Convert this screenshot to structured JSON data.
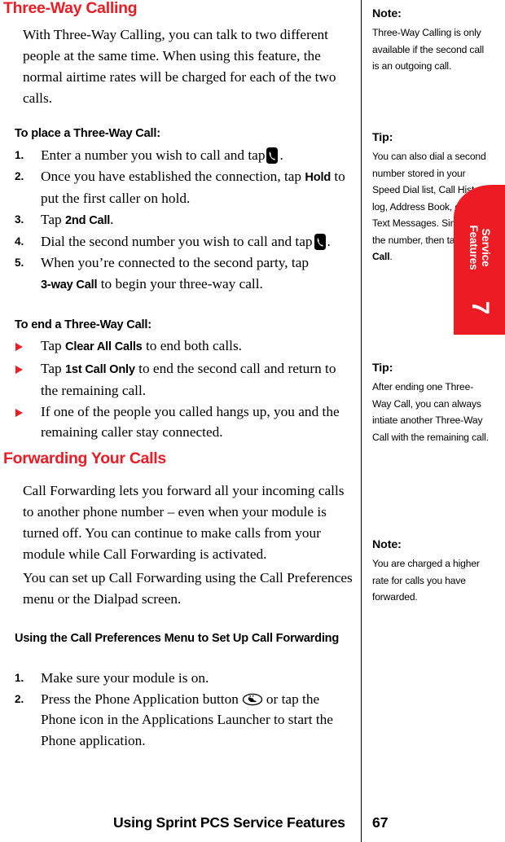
{
  "page": {
    "number": "67",
    "footer_title": "Using Sprint PCS Service Features",
    "accent_color": "#ED1C24"
  },
  "chapter_tab": {
    "label_line1": "Service",
    "label_line2": "Features",
    "number": "7"
  },
  "main": {
    "section1": {
      "title": "Three-Way Calling",
      "intro": "With Three-Way Calling, you can talk to two different people at the same time. When using this feature, the normal airtime rates will be charged for each of the two calls.",
      "place_heading": "To place a Three-Way Call:",
      "place_steps": [
        {
          "num": "1.",
          "text_before": "Enter a number you wish to call and tap",
          "icon": "phone-key-icon",
          "text_after": "."
        },
        {
          "num": "2.",
          "text_before": "Once you have established the connection, tap",
          "ui_term": "Hold",
          "text_after": "to put the first caller on hold."
        },
        {
          "num": "3.",
          "text_before": "Tap",
          "ui_term": "2nd Call",
          "text_after": "."
        },
        {
          "num": "4.",
          "text_before": "Dial the second number you wish to call and tap",
          "icon": "phone-key-icon",
          "text_after": "."
        },
        {
          "num": "5.",
          "text_before": "When you’re connected to the second party, tap",
          "ui_term": "3-way Call",
          "text_after": "to begin your three-way call."
        }
      ],
      "end_heading": "To end a Three-Way Call:",
      "end_steps": [
        {
          "bullet": "triangle-bullet-icon",
          "text_before": "Tap",
          "ui_term": "Clear All Calls",
          "text_after": "to end both calls."
        },
        {
          "bullet": "triangle-bullet-icon",
          "text_before": "Tap",
          "ui_term": "1st Call Only",
          "text_after": "to end the second call and return to the remaining call."
        },
        {
          "bullet": "triangle-bullet-icon",
          "text_before": "If one of the people you called hangs up, you and the remaining caller stay connected.",
          "ui_term": "",
          "text_after": ""
        }
      ]
    },
    "section2": {
      "title": "Forwarding Your Calls",
      "para1": "Call Forwarding lets you forward all your incoming calls to another phone number – even when your module is turned off. You can continue to make calls from your module while Call Forwarding is activated.",
      "para2": "You can set up Call Forwarding using the Call Preferences menu or the Dialpad screen.",
      "sub_heading": "Using the Call Preferences Menu to Set Up Call Forwarding",
      "steps": [
        {
          "num": "1.",
          "text_before": "Make sure your module is on.",
          "text_after": ""
        },
        {
          "num": "2.",
          "text_before": "Press the Phone Application button",
          "icon": "phone-application-button-icon",
          "text_after": "or tap the Phone icon in the Applications Launcher to start the Phone application."
        }
      ]
    }
  },
  "sidebar": {
    "blocks": [
      {
        "heading": "Note:",
        "body": "Three-Way Calling is only available if the second call is an outgoing call."
      },
      {
        "heading": "Tip:",
        "body_before": "You can also dial a second number stored in your Speed Dial list, Call History log, Address Book, or SMS Text Messages. Simply find the number, then tap",
        "ui_term": "3-way Call",
        "body_after": "."
      },
      {
        "heading": "Tip:",
        "body": "After ending one Three-Way Call, you can always intiate another Three-Way Call with the remaining call."
      },
      {
        "heading": "Note:",
        "body": "You are charged a higher rate for calls you have forwarded."
      }
    ]
  }
}
